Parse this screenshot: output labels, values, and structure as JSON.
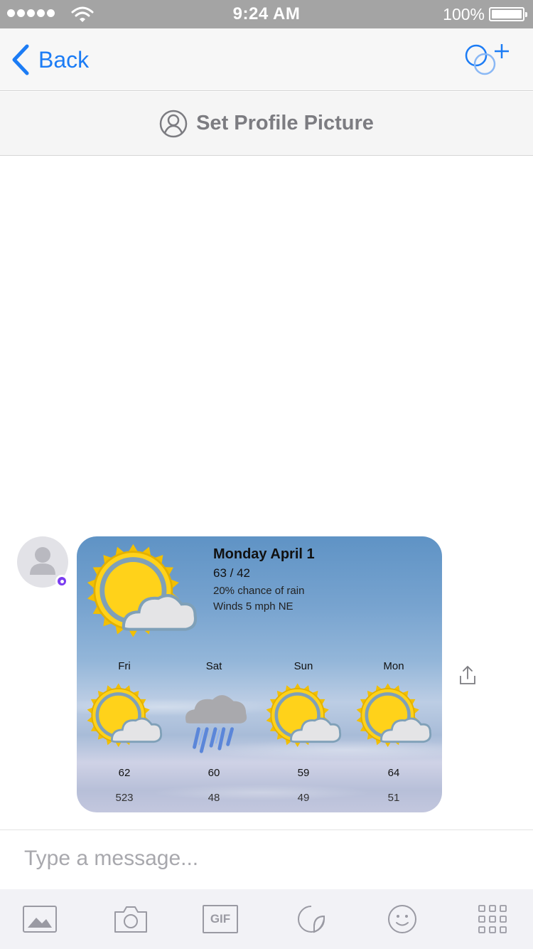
{
  "status_bar": {
    "time": "9:24 AM",
    "battery": "100%"
  },
  "nav": {
    "back_label": "Back"
  },
  "banner": {
    "label": "Set Profile Picture"
  },
  "weather": {
    "title": "Monday April 1",
    "temps": "63 / 42",
    "rain": "20% chance of rain",
    "wind": "Winds 5 mph NE",
    "days": [
      {
        "name": "Fri",
        "high": "62",
        "low": "523",
        "icon": "partly-sunny-icon"
      },
      {
        "name": "Sat",
        "high": "60",
        "low": "48",
        "icon": "rain-icon"
      },
      {
        "name": "Sun",
        "high": "59",
        "low": "49",
        "icon": "partly-sunny-icon"
      },
      {
        "name": "Mon",
        "high": "64",
        "low": "51",
        "icon": "partly-sunny-icon"
      }
    ]
  },
  "composer": {
    "placeholder": "Type a message..."
  },
  "toolbar": {
    "gif_label": "GIF"
  },
  "colors": {
    "accent": "#1c7cf5",
    "status_bar": "#a4a4a4",
    "badge": "#7a3cf0",
    "sun": "#f5c400",
    "cloud": "#e6e6e8"
  }
}
